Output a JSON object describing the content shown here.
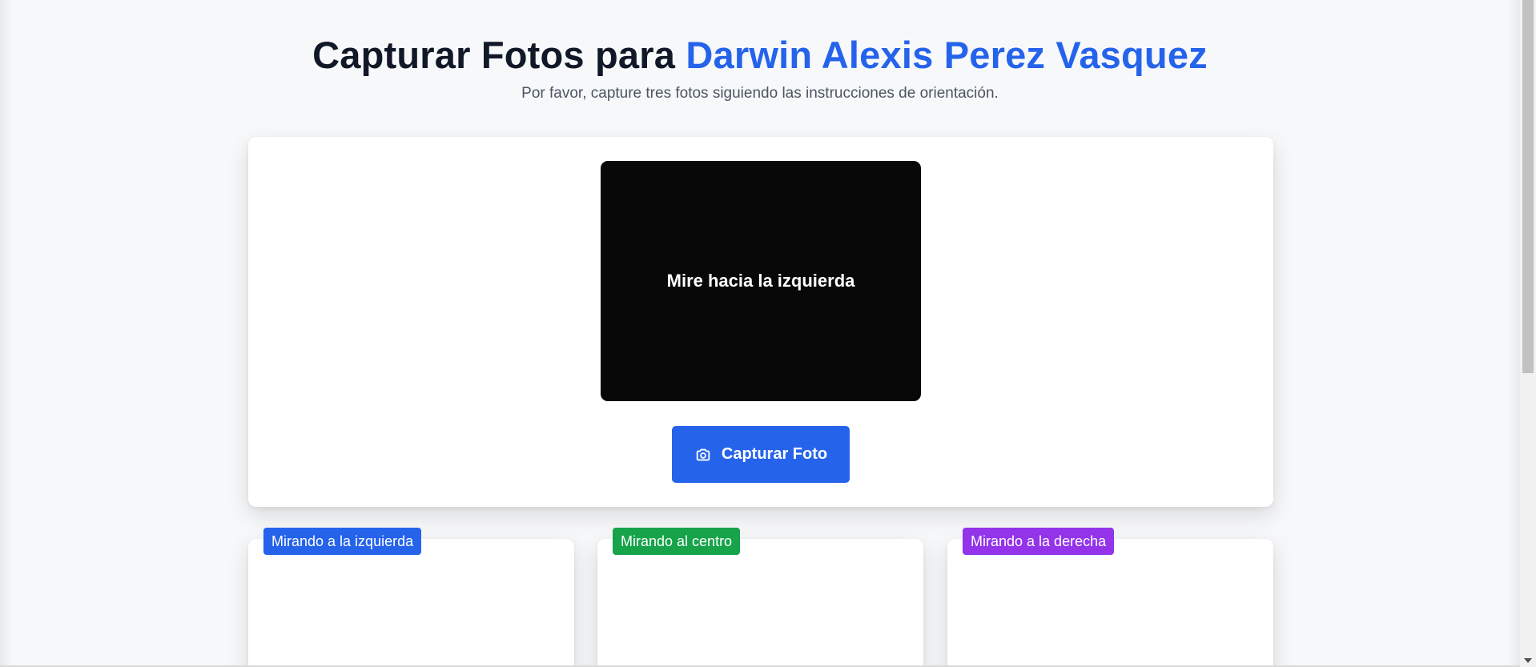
{
  "header": {
    "title_prefix": "Capturar Fotos para ",
    "title_name": "Darwin Alexis Perez Vasquez",
    "subtitle": "Por favor, capture tres fotos siguiendo las instrucciones de orientación."
  },
  "camera": {
    "instruction": "Mire hacia la izquierda"
  },
  "capture_button": {
    "label": "Capturar Foto",
    "icon": "camera-icon"
  },
  "thumbnails": [
    {
      "label": "Mirando a la izquierda",
      "color": "#2563eb"
    },
    {
      "label": "Mirando al centro",
      "color": "#16a34a"
    },
    {
      "label": "Mirando a la derecha",
      "color": "#9333ea"
    }
  ],
  "colors": {
    "accent": "#2563eb",
    "background": "#f8f9fb",
    "camera_bg": "#080808"
  }
}
